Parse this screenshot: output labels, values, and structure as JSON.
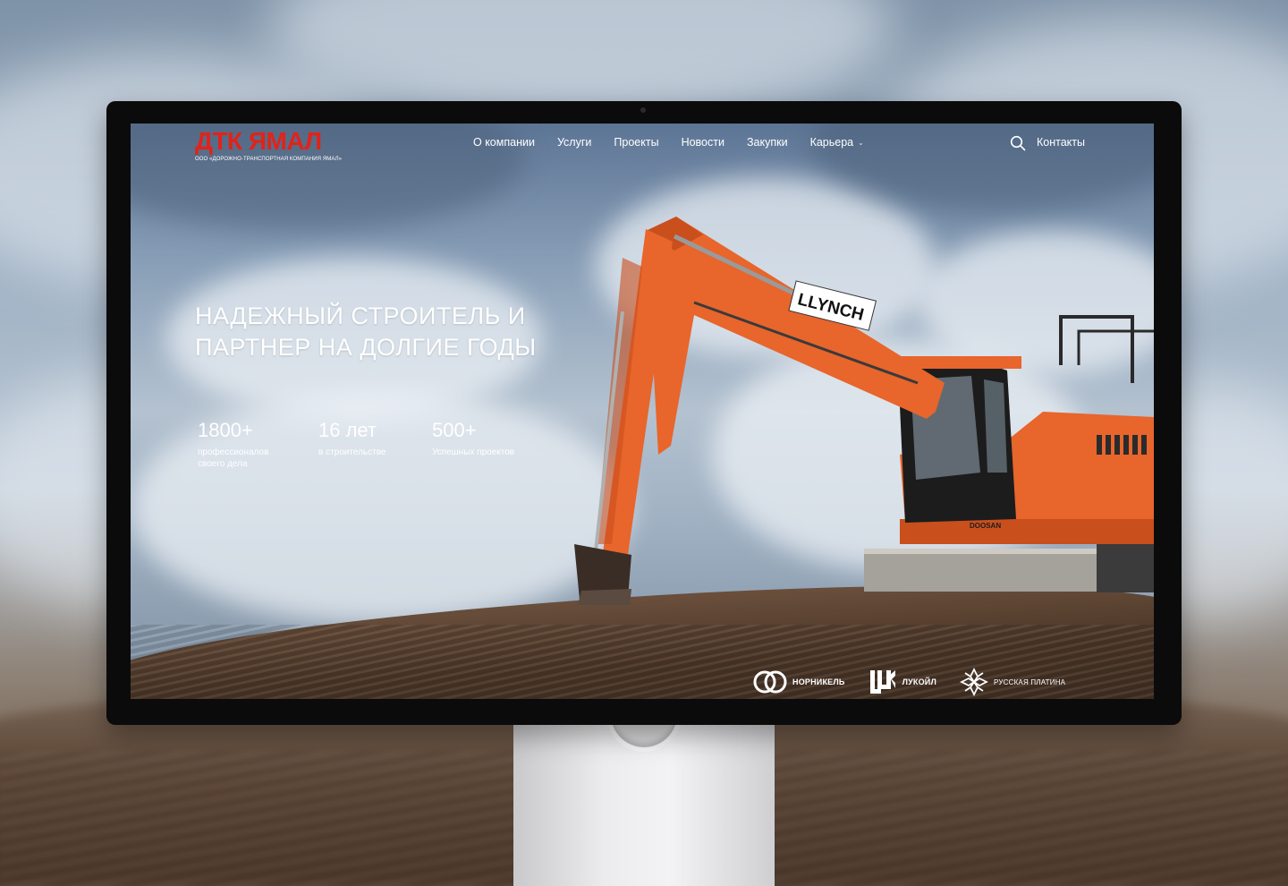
{
  "brand": {
    "title": "ДТК ЯМАЛ",
    "subtitle": "ООО «ДОРОЖНО-ТРАНСПОРТНАЯ КОМПАНИЯ ЯМАЛ»",
    "accent_color": "#e32219"
  },
  "nav": {
    "items": [
      {
        "label": "О компании"
      },
      {
        "label": "Услуги"
      },
      {
        "label": "Проекты"
      },
      {
        "label": "Новости"
      },
      {
        "label": "Закупки"
      },
      {
        "label": "Карьера",
        "has_dropdown": true
      }
    ],
    "search_icon": "search-icon",
    "contacts_label": "Контакты"
  },
  "hero": {
    "headline_line1": "НАДЕЖНЫЙ СТРОИТЕЛЬ И",
    "headline_line2": "ПАРТНЕР НА ДОЛГИЕ ГОДЫ",
    "excavator_label": "LLYNCH",
    "excavator_brand": "DOOSAN",
    "stats": [
      {
        "value": "1800+",
        "label": "профессионалов своего дела"
      },
      {
        "value": "16 лет",
        "label": "в строительстве"
      },
      {
        "value": "500+",
        "label": "Успешных  проектов"
      }
    ]
  },
  "partners": [
    {
      "name": "НОРНИКЕЛЬ",
      "icon": "nornickel-logo-icon"
    },
    {
      "name": "ЛУКОЙЛ",
      "icon": "lukoil-logo-icon"
    },
    {
      "name": "РУССКАЯ ПЛАТИНА",
      "icon": "russian-platinum-logo-icon"
    }
  ]
}
